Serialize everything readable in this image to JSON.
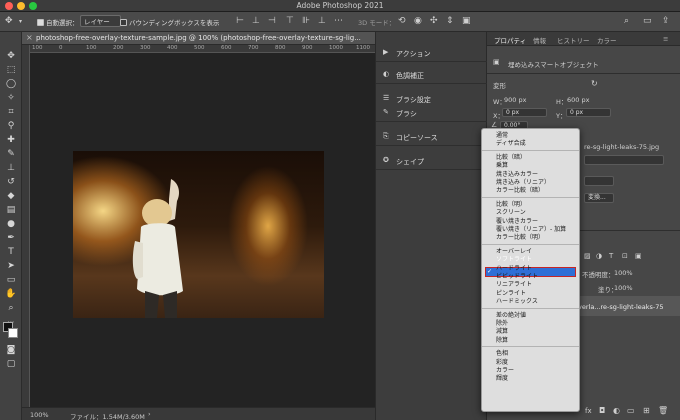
{
  "window": {
    "title": "Adobe Photoshop 2021"
  },
  "options_bar": {
    "auto_select_label": "自動選択：",
    "auto_select_value": "レイヤー",
    "bounding_box_label": "バウンディングボックスを表示",
    "mode_3d_label": "3D モード："
  },
  "document": {
    "tab_title": "photoshop-free-overlay-texture-sample.jpg @ 100% (photoshop-free-overlay-texture-sg-lig...",
    "zoom": "100%",
    "file_info": "ファイル：1.54M/3.60M",
    "ruler_ticks": [
      "100",
      "0",
      "100",
      "200",
      "300",
      "400",
      "500",
      "600",
      "700",
      "800",
      "900",
      "1000",
      "1100"
    ]
  },
  "mid_panel": {
    "items": [
      {
        "label": "アクション",
        "icon": "play-icon"
      },
      {
        "label": "色調補正",
        "icon": "adjustments-icon"
      },
      {
        "label": "ブラシ設定",
        "icon": "brush-settings-icon"
      },
      {
        "label": "ブラシ",
        "icon": "brush-icon"
      },
      {
        "label": "コピーソース",
        "icon": "clone-source-icon"
      },
      {
        "label": "シェイプ",
        "icon": "shape-icon"
      }
    ]
  },
  "right_panel": {
    "tabs": [
      "プロパティ",
      "情報",
      "ヒストリー",
      "カラー"
    ],
    "smart_object_label": "埋め込みスマートオブジェクト",
    "transform_label": "変形",
    "w_label": "W：",
    "w_value": "900 px",
    "h_label": "H：",
    "h_value": "600 px",
    "x_label": "X：",
    "x_value": "0 px",
    "y_label": "Y：",
    "y_value": "0 px",
    "angle_value": "0.00°",
    "file_name_partial": "re-sg-light-leaks-75.jpg",
    "button_partial": "変換...",
    "opacity_label": "不透明度：",
    "opacity_value": "100%",
    "fill_label": "塗り：",
    "fill_value": "100%",
    "layer_name_partial": "verla...re-sg-light-leaks-75"
  },
  "blend_menu": {
    "selected": "ソフトライト",
    "groups": [
      [
        "通常",
        "ディザ合成"
      ],
      [
        "比較（暗）",
        "乗算",
        "焼き込みカラー",
        "焼き込み（リニア）",
        "カラー比較（暗）"
      ],
      [
        "比較（明）",
        "スクリーン",
        "覆い焼きカラー",
        "覆い焼き（リニア）- 加算",
        "カラー比較（明）"
      ],
      [
        "オーバーレイ",
        "ソフトライト",
        "ハードライト",
        "ビビッドライト",
        "リニアライト",
        "ピンライト",
        "ハードミックス"
      ],
      [
        "差の絶対値",
        "除外",
        "減算",
        "除算"
      ],
      [
        "色相",
        "彩度",
        "カラー",
        "輝度"
      ]
    ]
  }
}
